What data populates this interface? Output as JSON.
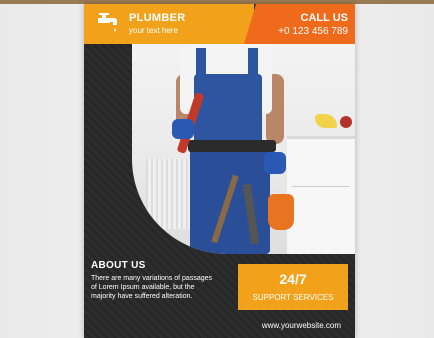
{
  "header": {
    "title": "PLUMBER",
    "subtitle": "your text here",
    "call_label": "CALL US",
    "phone": "+0 123 456 789"
  },
  "about": {
    "title": "ABOUT US",
    "text": "There are many variations of passages of Lorem Ipsum available, but the majority have suffered alteration."
  },
  "support": {
    "big": "24/7",
    "label": "SUPPORT SERVICES"
  },
  "footer": {
    "website": "www.yourwebsite.com"
  },
  "icons": {
    "header_icon": "faucet-icon"
  },
  "colors": {
    "accent_yellow": "#f2a21a",
    "accent_orange": "#ef6b1b",
    "dark": "#2b2b2b"
  }
}
